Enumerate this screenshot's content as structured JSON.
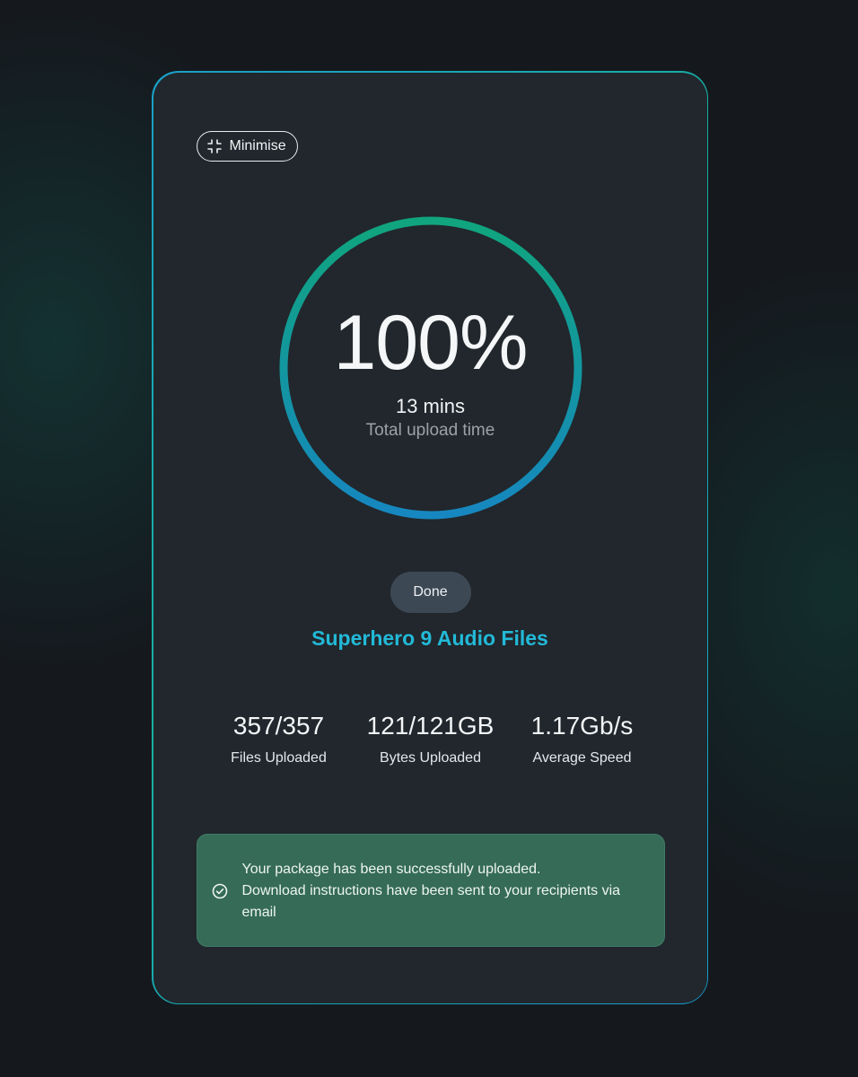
{
  "header": {
    "minimise_label": "Minimise",
    "minimise_icon": "minimize-arrows-icon"
  },
  "progress": {
    "percent_label": "100%",
    "fraction": 1.0,
    "duration": "13 mins",
    "duration_label": "Total upload time",
    "gradient_start": "#1687c0",
    "gradient_end": "#10a57e"
  },
  "status": {
    "done_label": "Done"
  },
  "package": {
    "name": "Superhero 9 Audio Files"
  },
  "stats": [
    {
      "value": "357/357",
      "label": "Files Uploaded"
    },
    {
      "value": "121/121GB",
      "label": "Bytes Uploaded"
    },
    {
      "value": "1.17Gb/s",
      "label": "Average Speed"
    }
  ],
  "success": {
    "icon": "check-circle-icon",
    "line1": "Your package has been successfully uploaded.",
    "line2": "Download instructions have been sent to your recipients via email"
  },
  "colors": {
    "accent": "#22b9d8",
    "success_bg": "#356b57",
    "card_bg": "#21272c",
    "page_bg": "#15191e"
  }
}
